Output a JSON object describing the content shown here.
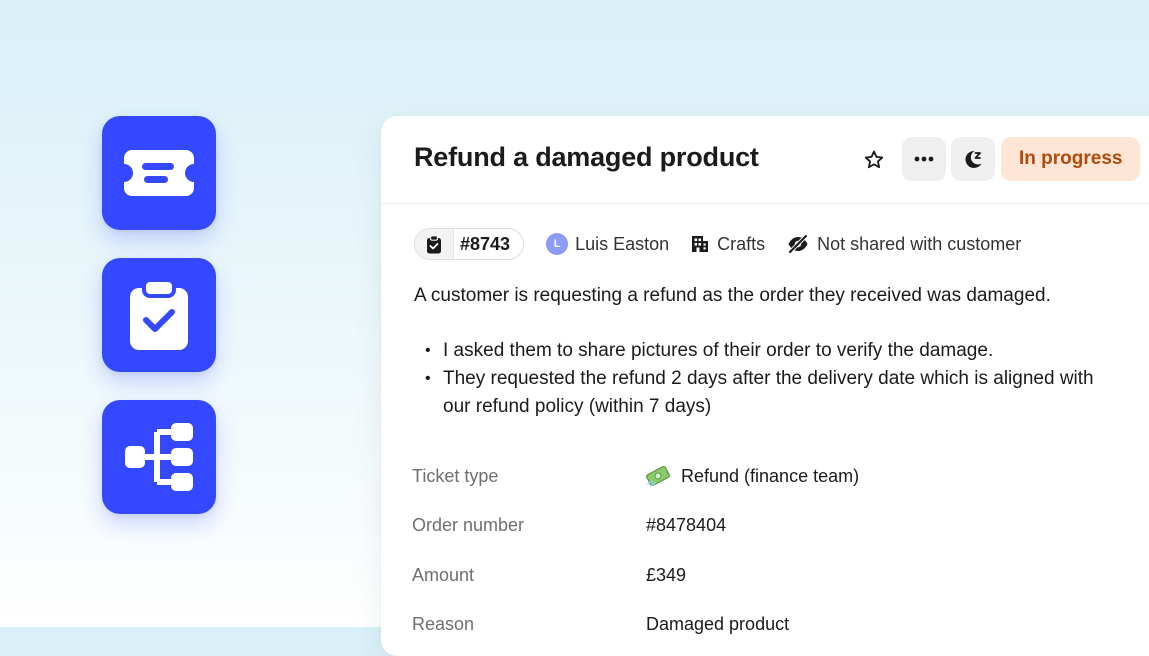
{
  "ticket": {
    "title": "Refund a damaged product",
    "status": "In progress",
    "id": "#8743",
    "assignee": {
      "initial": "L",
      "name": "Luis Easton"
    },
    "team": "Crafts",
    "visibility": "Not shared with customer",
    "description": "A customer is requesting a refund as the order they received was damaged.",
    "notes": [
      "I asked them to share pictures of their order to verify the damage.",
      "They requested the refund 2 days after the delivery date which is aligned with our refund policy (within 7 days)"
    ],
    "attributes": {
      "ticket_type": {
        "label": "Ticket type",
        "value": "Refund (finance team)"
      },
      "order_number": {
        "label": "Order number",
        "value": "#8478404"
      },
      "amount": {
        "label": "Amount",
        "value": "£349"
      },
      "reason": {
        "label": "Reason",
        "value": "Damaged product"
      }
    }
  },
  "icons": {
    "feature_1": "ticket-icon",
    "feature_2": "clipboard-check-icon",
    "feature_3": "workflow-tree-icon",
    "star": "star-icon",
    "more": "more-dots-icon",
    "snooze": "snooze-moon-icon",
    "ticket_chip": "clipboard-check-icon",
    "team": "building-icon",
    "visibility": "eye-off-icon",
    "ticket_type": "money-icon"
  },
  "colors": {
    "accent": "#3448ff",
    "status_bg": "#fde6d6",
    "status_text": "#b14a0c",
    "avatar": "#8c9bf7"
  }
}
